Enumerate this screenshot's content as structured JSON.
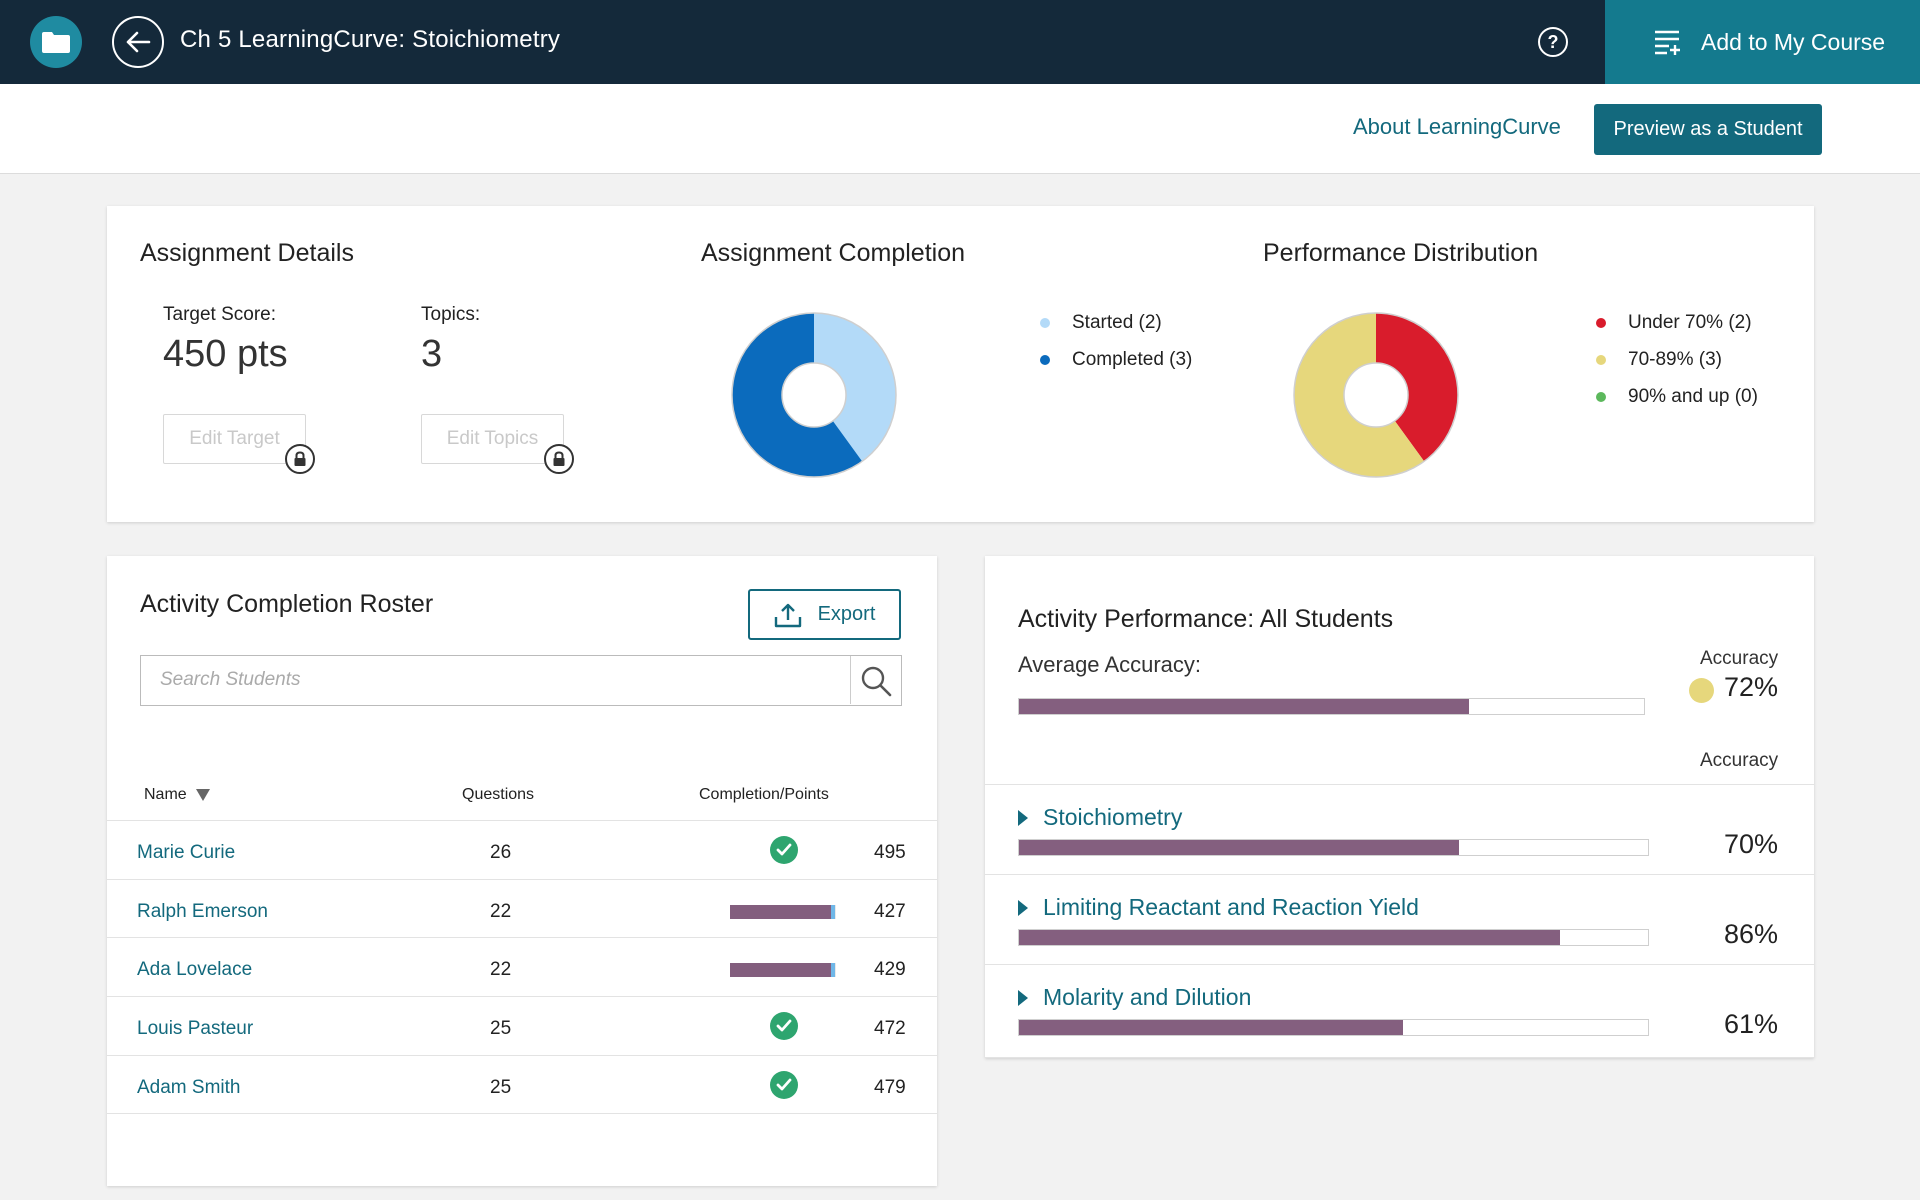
{
  "header": {
    "title": "Ch 5 LearningCurve: Stoichiometry",
    "add_course_label": "Add to My Course",
    "help_glyph": "?"
  },
  "subheader": {
    "about_link": "About LearningCurve",
    "preview_button": "Preview as a Student"
  },
  "assignment_details": {
    "title": "Assignment Details",
    "target_label": "Target Score:",
    "target_value": "450 pts",
    "topics_label": "Topics:",
    "topics_value": "3",
    "edit_target": "Edit Target",
    "edit_topics": "Edit Topics"
  },
  "assignment_completion": {
    "title": "Assignment Completion",
    "legend": [
      {
        "label": "Started (2)",
        "color": "#b3daf8"
      },
      {
        "label": "Completed (3)",
        "color": "#0b6bbd"
      }
    ]
  },
  "performance_distribution": {
    "title": "Performance Distribution",
    "legend": [
      {
        "label": "Under 70% (2)",
        "color": "#d91c2c"
      },
      {
        "label": "70-89% (3)",
        "color": "#e6d77c"
      },
      {
        "label": "90% and up (0)",
        "color": "#5cb85c"
      }
    ]
  },
  "chart_data": [
    {
      "type": "pie",
      "title": "Assignment Completion",
      "categories": [
        "Started",
        "Completed"
      ],
      "values": [
        2,
        3
      ],
      "colors": [
        "#b3daf8",
        "#0b6bbd"
      ]
    },
    {
      "type": "pie",
      "title": "Performance Distribution",
      "categories": [
        "Under 70%",
        "70-89%",
        "90% and up"
      ],
      "values": [
        2,
        3,
        0
      ],
      "colors": [
        "#d91c2c",
        "#e6d77c",
        "#5cb85c"
      ]
    }
  ],
  "roster": {
    "title": "Activity Completion Roster",
    "export_label": "Export",
    "search_placeholder": "Search Students",
    "columns": {
      "name": "Name",
      "questions": "Questions",
      "completion": "Completion/Points"
    },
    "rows": [
      {
        "name": "Marie Curie",
        "questions": "26",
        "completed": true,
        "progress": 1.0,
        "points": "495"
      },
      {
        "name": "Ralph Emerson",
        "questions": "22",
        "completed": false,
        "progress": 0.95,
        "points": "427"
      },
      {
        "name": "Ada Lovelace",
        "questions": "22",
        "completed": false,
        "progress": 0.95,
        "points": "429"
      },
      {
        "name": "Louis Pasteur",
        "questions": "25",
        "completed": true,
        "progress": 1.0,
        "points": "472"
      },
      {
        "name": "Adam Smith",
        "questions": "25",
        "completed": true,
        "progress": 1.0,
        "points": "479"
      }
    ]
  },
  "activity_performance": {
    "title": "Activity Performance: All Students",
    "average_label": "Average Accuracy:",
    "accuracy_header": "Accuracy",
    "average_value": "72%",
    "average_fraction": 0.72,
    "average_dot_color": "#e6d77c",
    "topics_header": "Accuracy",
    "topics": [
      {
        "name": "Stoichiometry",
        "value": "70%",
        "fraction": 0.7
      },
      {
        "name": "Limiting Reactant and Reaction Yield",
        "value": "86%",
        "fraction": 0.86
      },
      {
        "name": "Molarity and Dilution",
        "value": "61%",
        "fraction": 0.61
      }
    ]
  }
}
